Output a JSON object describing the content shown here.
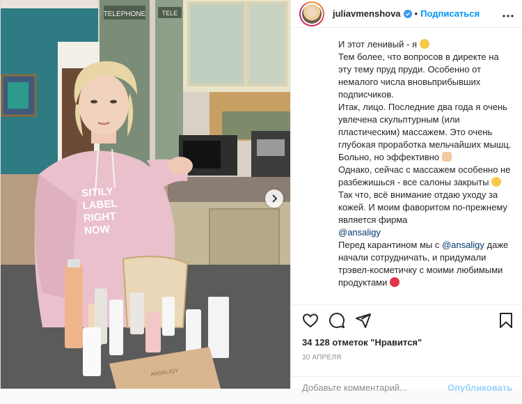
{
  "header": {
    "username": "juliavmenshova",
    "separator": "•",
    "follow_label": "Подписаться"
  },
  "caption": {
    "lines": [
      "И этот ленивый - я",
      "Тем более, что вопросов в директе на эту тему пруд пруди. Особенно от немалого числа вновьприбывших подписчиков.",
      "Итак, лицо. Последние два года я очень увлечена скульптурным (или пластическим) массажем. Это очень глубокая проработка мельчайших мышц. Больно, но эффективно",
      "Однако, сейчас с массажем особенно не разбежишься - все салоны закрыты",
      "Так что, всё внимание отдаю уходу за кожей. И моим фаворитом по-прежнему является фирма",
      "@ansaligy",
      "Перед карантином мы с",
      "@ansaligy",
      "даже начали сотрудничать, и придумали трэвел-косметичку с моими любимыми продуктами"
    ]
  },
  "photo": {
    "sign_telephone": "TELEPHONE",
    "sign_tele": "TELE",
    "hoodie_lines": [
      "SITILY",
      "LABEL",
      "RIGHT",
      "NOW"
    ],
    "product_brand": "ANSALIGY"
  },
  "stats": {
    "likes": "34 128 отметок \"Нравится\"",
    "date": "30 АПРЕЛЯ"
  },
  "comment": {
    "placeholder": "Добавьте комментарий...",
    "publish_label": "Опубликовать"
  },
  "colors": {
    "link": "#0095f6",
    "mention": "#00376b",
    "text": "#262626",
    "muted": "#8e8e8e"
  },
  "icons": {
    "like": "heart-icon",
    "comment": "comment-icon",
    "share": "share-icon",
    "save": "bookmark-icon",
    "more": "more-icon",
    "next": "chevron-right-icon"
  }
}
